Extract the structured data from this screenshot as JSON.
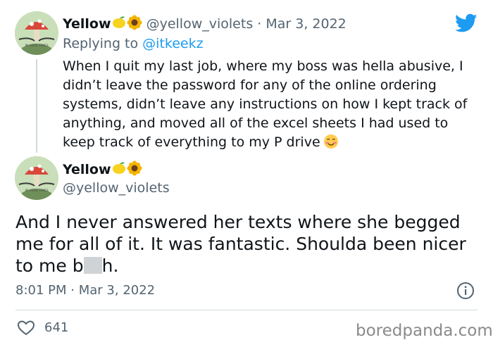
{
  "tweet1": {
    "display_name": "Yellow",
    "name_emojis": [
      "lemon-emoji",
      "sunflower-emoji"
    ],
    "handle": "@yellow_violets",
    "date": "Mar 3, 2022",
    "separator": "·",
    "replying_label": "Replying to",
    "replying_handle": "@itkeekz",
    "text": "When I quit my last job, where my boss was hella abusive, I didn’t leave the password for any of the online ordering systems, didn’t leave any instructions on how I kept track of anything, and moved all of the excel sheets I had used to keep track of everything to my P drive",
    "text_emoji": "smiling-face-with-blush-emoji",
    "avatar_text": "IN VERS TIMES"
  },
  "tweet2": {
    "display_name": "Yellow",
    "name_emojis": [
      "lemon-emoji",
      "sunflower-emoji"
    ],
    "handle": "@yellow_violets",
    "text_before_censor": "And I never answered her texts where she begged me for all of it. It was fantastic. Shoulda been nicer to me b",
    "text_after_censor": "h.",
    "time": "8:01 PM",
    "separator": "·",
    "date": "Mar 3, 2022",
    "likes": "641",
    "avatar_text": "IN VERS TIMES"
  },
  "icons": {
    "brand": "twitter-bird-icon",
    "info": "info-icon",
    "like": "heart-icon"
  },
  "colors": {
    "twitter_blue": "#1d9bf0",
    "muted_text": "#536471",
    "divider": "#cfd9de"
  },
  "watermark": "boredpanda.com"
}
